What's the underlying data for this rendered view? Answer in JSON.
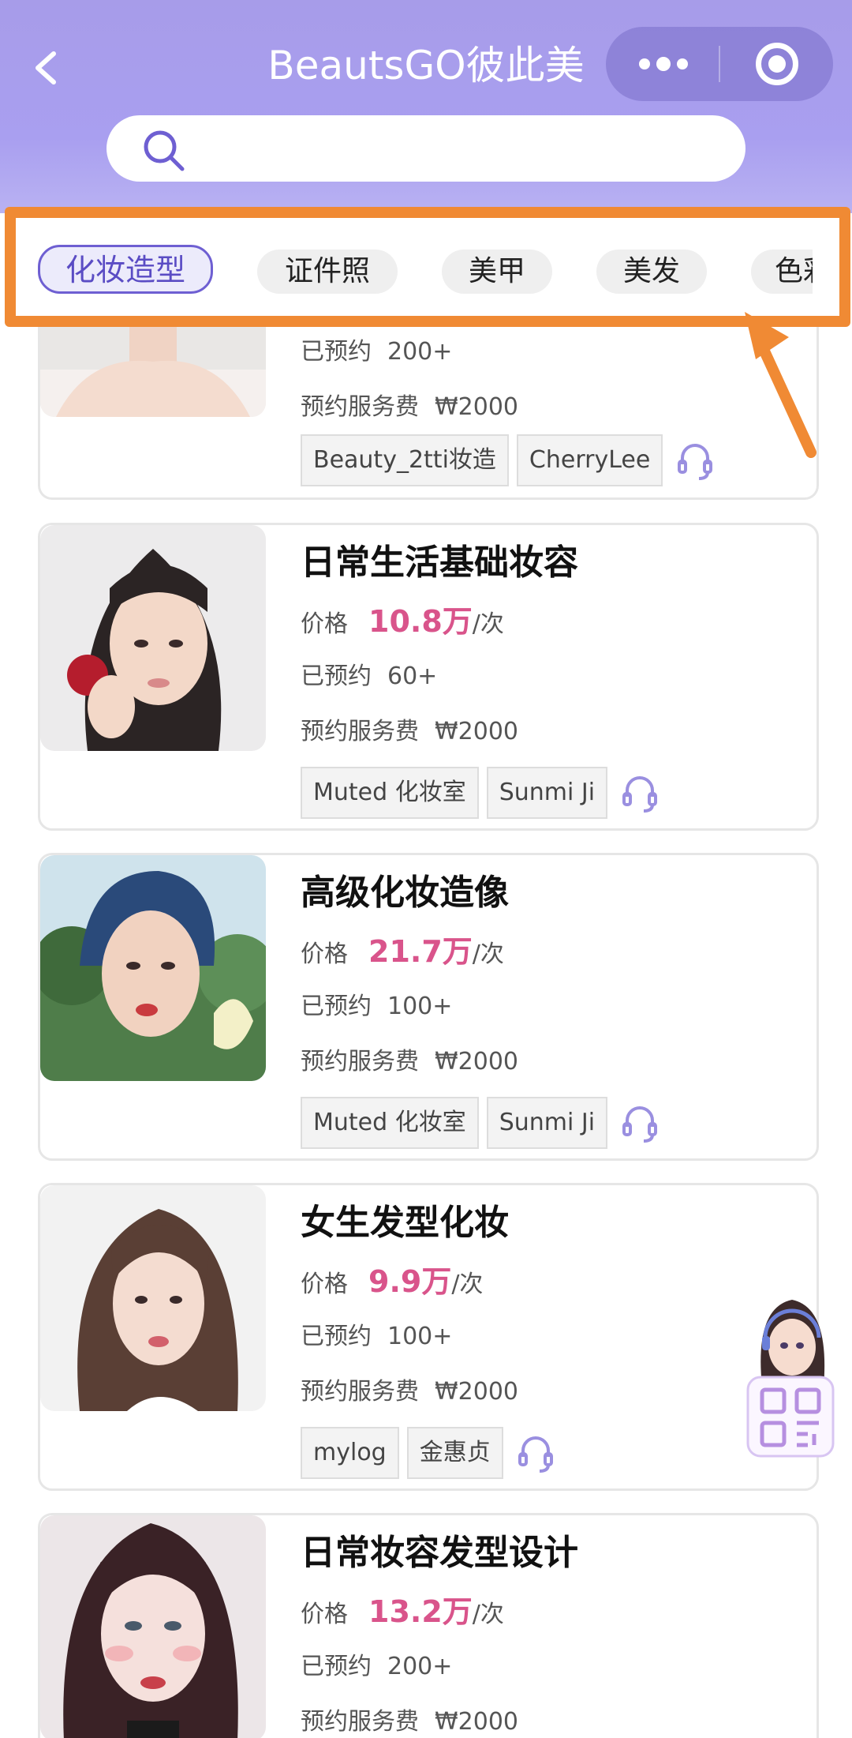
{
  "header": {
    "title": "BeautsGO彼此美",
    "search": {
      "placeholder": ""
    }
  },
  "tabs": [
    "化妆造型",
    "证件照",
    "美甲",
    "美发",
    "色彩"
  ],
  "active_tab": "化妆造型",
  "labels": {
    "price": "价格",
    "booked": "已预约",
    "fee": "预约服务费",
    "unit": "/次"
  },
  "cards": [
    {
      "name": "",
      "booked": "200+",
      "fee": "₩2000",
      "tags": [
        "Beauty_2tti妆造",
        "CherryLee"
      ]
    },
    {
      "name": "日常生活基础妆容",
      "price": "10.8万",
      "booked": "60+",
      "fee": "₩2000",
      "tags": [
        "Muted 化妆室",
        "Sunmi Ji"
      ]
    },
    {
      "name": "高级化妆造像",
      "price": "21.7万",
      "booked": "100+",
      "fee": "₩2000",
      "tags": [
        "Muted 化妆室",
        "Sunmi Ji"
      ]
    },
    {
      "name": "女生发型化妆",
      "price": "9.9万",
      "booked": "100+",
      "fee": "₩2000",
      "tags": [
        "mylog",
        "金惠贞"
      ]
    },
    {
      "name": "日常妆容发型设计",
      "price": "13.2万",
      "booked": "200+",
      "fee": "₩2000",
      "tags": []
    }
  ],
  "colors": {
    "header": "#a99ff0",
    "accent": "#6e5fd2",
    "price": "#d9548b",
    "highlight": "#f08a34"
  },
  "icons": [
    "back-icon",
    "more-icon",
    "target-icon",
    "search-icon",
    "customer-service-icon",
    "qr-code-icon"
  ]
}
